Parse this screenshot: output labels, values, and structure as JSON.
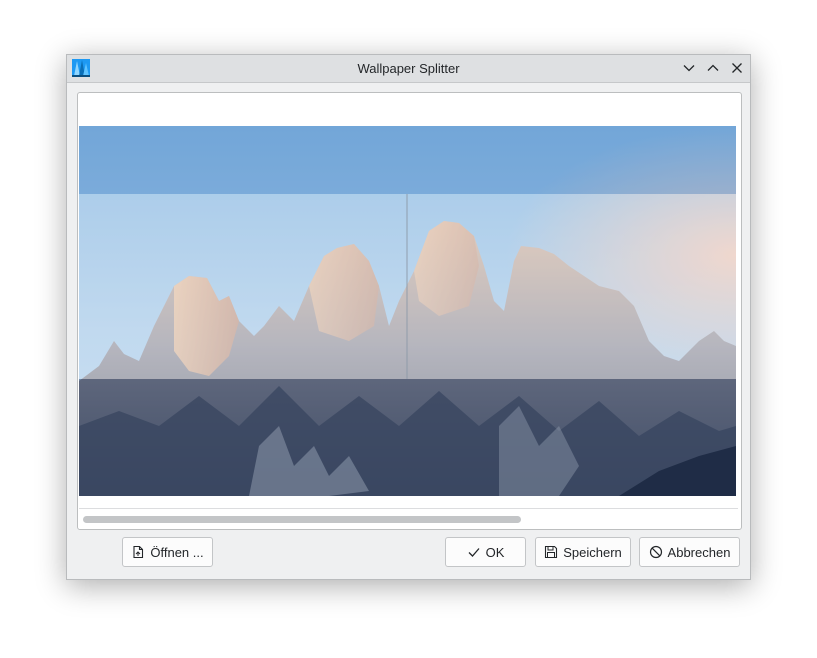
{
  "window": {
    "title": "Wallpaper Splitter"
  },
  "icons": {
    "app": "kde-app-icon",
    "minimize": "chevron-down-icon",
    "maximize": "chevron-up-icon",
    "close": "close-icon"
  },
  "buttons": {
    "open_label": "Öffnen ...",
    "ok_label": "OK",
    "save_label": "Speichern",
    "cancel_label": "Abbrechen"
  },
  "colors": {
    "window_bg": "#eff0f1",
    "titlebar_bg": "#dee0e2",
    "app_icon_blue": "#1d99f3"
  }
}
